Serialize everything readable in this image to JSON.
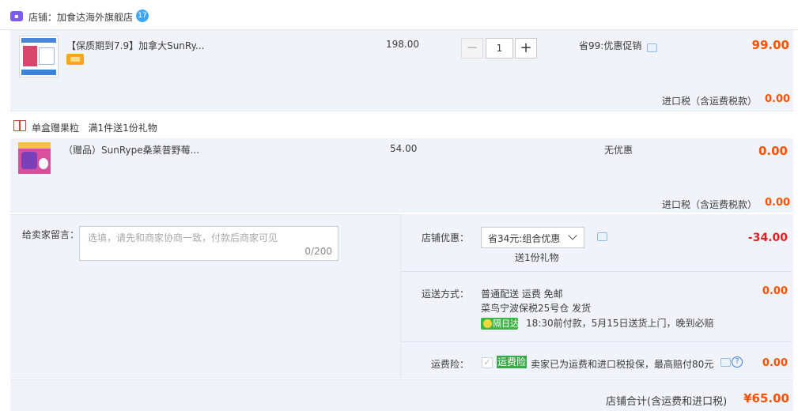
{
  "shop": {
    "icon": "shop-icon",
    "name": "店铺：加食达海外旗舰店",
    "chat_badge": "17"
  },
  "item1": {
    "title": "【保质期到7.9】加拿大SunRy...",
    "unit_price": "198.00",
    "quantity": "1",
    "minus_symbol": "−",
    "plus_symbol": "+",
    "promotion": "省99:优惠促销",
    "amount": "99.00",
    "tax_label": "进口税（含运费税款）",
    "tax_value": "0.00"
  },
  "gift_bundle": {
    "label": "单盒赠果粒",
    "rule": "满1件送1份礼物"
  },
  "item2": {
    "title": "（赠品）SunRype桑莱普野莓...",
    "unit_price": "54.00",
    "promotion": "无优惠",
    "amount": "0.00",
    "tax_label": "进口税（含运费税款）",
    "tax_value": "0.00"
  },
  "message": {
    "label": "给卖家留言：",
    "placeholder": "选填，请先和商家协商一致，付款后商家可见",
    "counter": "0/200"
  },
  "shop_discount": {
    "label": "店铺优惠：",
    "selected": "省34元:组合优惠",
    "amount": "-34.00",
    "gift_note": "送1份礼物"
  },
  "shipping": {
    "label": "运送方式：",
    "line1": "普通配送 运费 免邮",
    "line2": "菜鸟宁波保税25号仓   发货",
    "badge": "隔日达",
    "line3": "18:30前付款，5月15日送货上门，晚到必赔",
    "amount": "0.00"
  },
  "insurance": {
    "label": "运费险：",
    "check": "✓",
    "badge": "运费险",
    "text": "卖家已为运费和进口税投保，最高赔付80元",
    "help": "?",
    "amount": "0.00"
  },
  "total": {
    "label": "店铺合计(含运费和进口税)",
    "value": "¥65.00"
  },
  "colors": {
    "price_orange": "#ff5000",
    "discount_red": "#e02020",
    "panel_bg": "#f0f4fa",
    "insurance_green": "#39a84a"
  }
}
